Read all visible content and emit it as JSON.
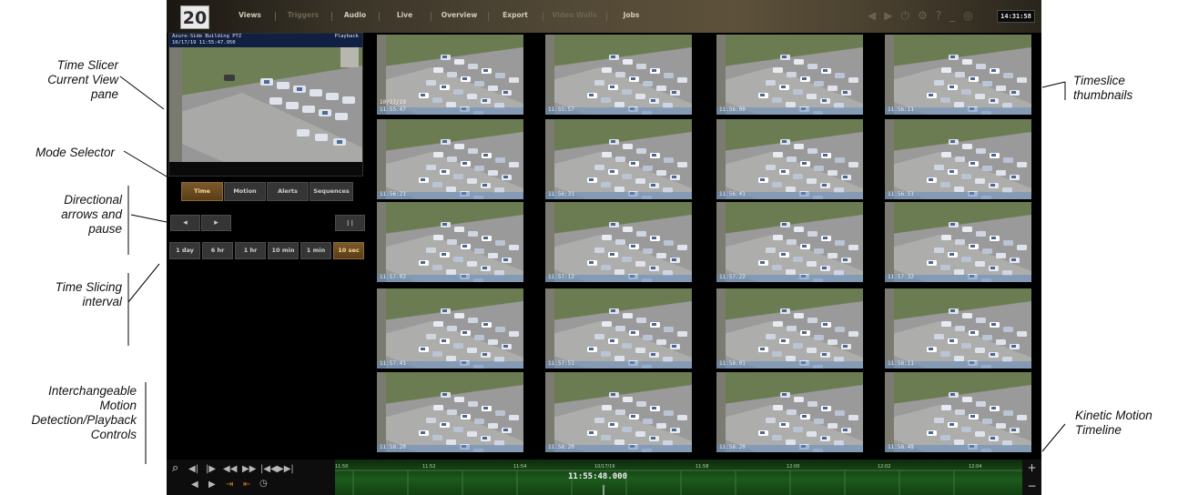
{
  "annotations": {
    "time_slicer": "Time Slicer\nCurrent View\npane",
    "mode_selector": "Mode Selector",
    "directional": "Directional\narrows and\npause",
    "time_slicing": "Time Slicing\ninterval",
    "interchangeable": "Interchangeable\nMotion\nDetection/Playback\nControls",
    "timeslice_thumbnails": "Timeslice\nthumbnails",
    "kinetic": "Kinetic Motion\nTimeline"
  },
  "app": {
    "logo": "20",
    "nav": [
      "Views",
      "Triggers",
      "Audio",
      "Live",
      "Overview",
      "Export",
      "Video Walls",
      "Jobs"
    ],
    "clock": "14:31:58",
    "top_icons": [
      "back-icon",
      "forward-icon",
      "power-icon",
      "settings-icon",
      "help-icon",
      "minimize-icon",
      "info-icon"
    ]
  },
  "current_view": {
    "camera": "Azure-Side Building PTZ",
    "mode": "Playback",
    "datetime": "10/17/19 11:55:47.950"
  },
  "modes": [
    "Time",
    "Motion",
    "Alerts",
    "Sequences"
  ],
  "active_mode": "Time",
  "directional": {
    "prev": "◂",
    "next": "▸",
    "pause": "| |"
  },
  "intervals": [
    "1 day",
    "6 hr",
    "1 hr",
    "10 min",
    "1 min",
    "10 sec"
  ],
  "active_interval": "10 sec",
  "thumbnails": [
    [
      "11:55:47",
      "11:55:57",
      "11:56:00",
      "11:56:11"
    ],
    [
      "11:56:21",
      "11:56:31",
      "11:56:41",
      "11:56:51"
    ],
    [
      "11:57:02",
      "11:57:12",
      "11:57:22",
      "11:57:32"
    ],
    [
      "11:57:41",
      "11:57:51",
      "11:58:01",
      "11:58:11"
    ],
    [
      "11:58:20",
      "11:58:20",
      "11:58:20",
      "11:58:48"
    ]
  ],
  "first_thumb_date": "10/17/19",
  "timeline": {
    "ticks": [
      "11:50",
      "11:52",
      "11:54",
      "11:58",
      "12:00",
      "12:02",
      "12:04"
    ],
    "date": "10/17/19",
    "current": "11:55:48.000",
    "zoom_in": "+",
    "zoom_out": "−"
  },
  "controls": {
    "row1": [
      "search-icon",
      "step-back-icon",
      "step-forward-icon",
      "rewind-icon",
      "fast-forward-icon",
      "skip-start-icon",
      "skip-end-icon"
    ],
    "row2": [
      "play-reverse-icon",
      "play-icon",
      "mark-in-icon",
      "mark-out-icon",
      "clock-icon"
    ]
  }
}
